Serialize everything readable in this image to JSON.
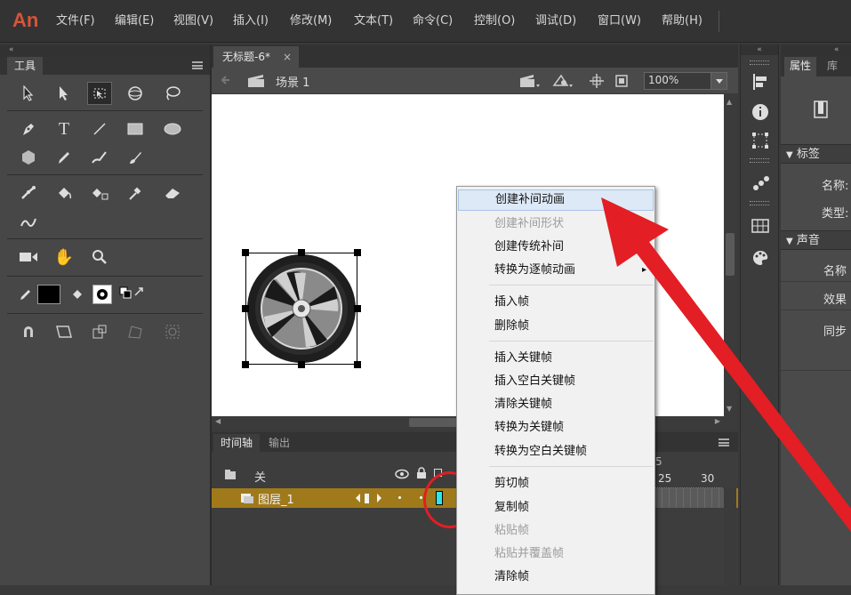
{
  "app": {
    "logo": "An"
  },
  "menu": [
    "文件(F)",
    "编辑(E)",
    "视图(V)",
    "插入(I)",
    "修改(M)",
    "文本(T)",
    "命令(C)",
    "控制(O)",
    "调试(D)",
    "窗口(W)",
    "帮助(H)"
  ],
  "tools_panel": {
    "title": "工具"
  },
  "document": {
    "tab_title": "无标题-6*",
    "close": "×",
    "scene": "场景 1",
    "zoom": "100%"
  },
  "timeline": {
    "tabs": [
      "时间轴",
      "输出"
    ],
    "folder_label": "关",
    "layer_name": "图层_1",
    "frame_numbers": [
      "5",
      "25",
      "30"
    ]
  },
  "properties": {
    "tabs": [
      "属性",
      "库"
    ],
    "section_label": "标签",
    "name_label": "名称:",
    "type_label": "类型:",
    "section_sound": "声音",
    "sound_name": "名称",
    "effect": "效果",
    "sync": "同步"
  },
  "context_menu": {
    "items": [
      {
        "label": "创建补间动画",
        "state": "highlighted"
      },
      {
        "label": "创建补间形状",
        "state": "disabled"
      },
      {
        "label": "创建传统补间",
        "state": "normal"
      },
      {
        "label": "转换为逐帧动画",
        "state": "normal",
        "submenu": "▸"
      },
      {
        "label": "插入帧",
        "state": "normal"
      },
      {
        "label": "删除帧",
        "state": "normal"
      },
      {
        "label": "插入关键帧",
        "state": "normal"
      },
      {
        "label": "插入空白关键帧",
        "state": "normal"
      },
      {
        "label": "清除关键帧",
        "state": "normal"
      },
      {
        "label": "转换为关键帧",
        "state": "normal"
      },
      {
        "label": "转换为空白关键帧",
        "state": "normal"
      },
      {
        "label": "剪切帧",
        "state": "normal"
      },
      {
        "label": "复制帧",
        "state": "normal"
      },
      {
        "label": "粘贴帧",
        "state": "disabled"
      },
      {
        "label": "粘贴并覆盖帧",
        "state": "disabled"
      },
      {
        "label": "清除帧",
        "state": "normal"
      }
    ]
  },
  "annotation": {
    "arrow_color": "#e31e24",
    "circle_color": "#e31e24"
  },
  "colors": {
    "menubar": "#333333",
    "panel": "#4a4a4a",
    "layer_highlight": "#a07a1a",
    "frame_cyan": "#2ee6e6"
  }
}
